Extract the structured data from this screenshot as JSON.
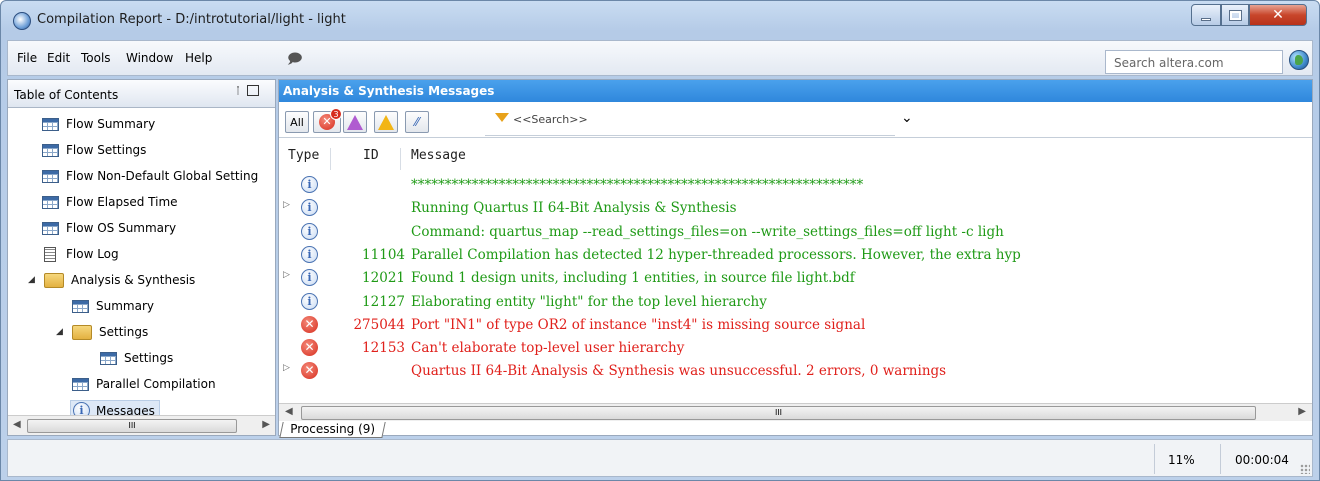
{
  "window": {
    "title": "Compilation Report - D:/introtutorial/light - light"
  },
  "menu": {
    "items": [
      "File",
      "Edit",
      "Tools",
      "Window",
      "Help"
    ],
    "search_placeholder": "Search altera.com"
  },
  "toc": {
    "title": "Table of Contents",
    "items": [
      {
        "label": "Flow Summary",
        "icon": "table-icon"
      },
      {
        "label": "Flow Settings",
        "icon": "table-icon"
      },
      {
        "label": "Flow Non-Default Global Setting",
        "icon": "table-icon"
      },
      {
        "label": "Flow Elapsed Time",
        "icon": "table-icon"
      },
      {
        "label": "Flow OS Summary",
        "icon": "table-icon"
      },
      {
        "label": "Flow Log",
        "icon": "document-icon"
      },
      {
        "label": "Analysis & Synthesis",
        "icon": "folder-icon"
      },
      {
        "label": "Summary",
        "icon": "table-icon"
      },
      {
        "label": "Settings",
        "icon": "folder-icon"
      },
      {
        "label": "Settings",
        "icon": "table-icon"
      },
      {
        "label": "Parallel Compilation",
        "icon": "table-icon"
      },
      {
        "label": "Messages",
        "icon": "info-icon"
      }
    ]
  },
  "messages_panel": {
    "title": "Analysis & Synthesis Messages",
    "filter_all": "All",
    "error_count": "3",
    "search_placeholder": "<<Search>>",
    "columns": {
      "type": "Type",
      "id": "ID",
      "message": "Message"
    },
    "rows": [
      {
        "type": "info",
        "expandable": false,
        "id": "",
        "message": "*******************************************************************",
        "color": "#1f9a16"
      },
      {
        "type": "info",
        "expandable": true,
        "id": "",
        "message": "Running Quartus II 64-Bit Analysis & Synthesis",
        "color": "#1f9a16"
      },
      {
        "type": "info",
        "expandable": false,
        "id": "",
        "message": "Command: quartus_map --read_settings_files=on --write_settings_files=off light -c ligh",
        "color": "#1f9a16"
      },
      {
        "type": "info",
        "expandable": false,
        "id": "11104",
        "message": "Parallel Compilation has detected 12 hyper-threaded processors. However, the extra hyp",
        "color": "#1f9a16"
      },
      {
        "type": "info",
        "expandable": true,
        "id": "12021",
        "message": "Found 1 design units, including 1 entities, in source file light.bdf",
        "color": "#1f9a16"
      },
      {
        "type": "info",
        "expandable": false,
        "id": "12127",
        "message": "Elaborating entity \"light\" for the top level hierarchy",
        "color": "#1f9a16"
      },
      {
        "type": "error",
        "expandable": false,
        "id": "275044",
        "message": "Port \"IN1\" of type OR2 of instance \"inst4\" is missing source signal",
        "color": "#e0201b"
      },
      {
        "type": "error",
        "expandable": false,
        "id": "12153",
        "message": "Can't elaborate top-level user hierarchy",
        "color": "#e0201b"
      },
      {
        "type": "error",
        "expandable": true,
        "id": "",
        "message": "Quartus II 64-Bit Analysis & Synthesis was unsuccessful. 2 errors, 0 warnings",
        "color": "#e0201b"
      }
    ],
    "tab_label": "Processing (9)"
  },
  "status": {
    "progress": "11%",
    "elapsed": "00:00:04"
  }
}
